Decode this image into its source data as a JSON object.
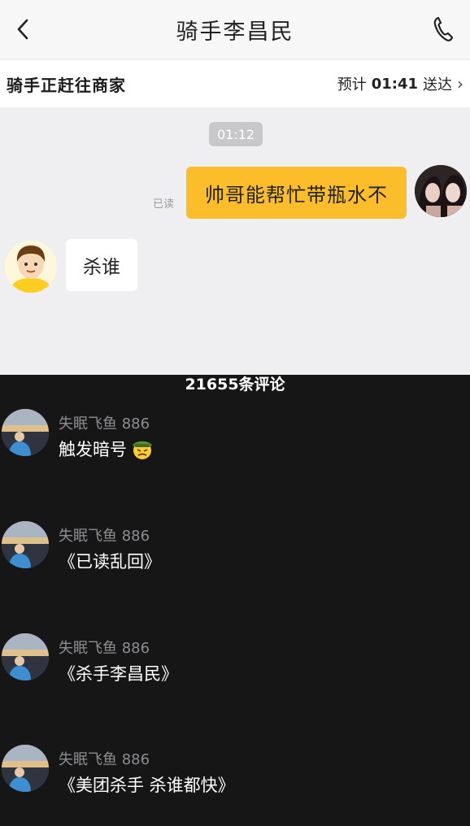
{
  "chat": {
    "title": "骑手李昌民",
    "status_left": "骑手正赶往商家",
    "eta_label": "预计",
    "eta_time": "01:41",
    "eta_suffix": "送达",
    "time_stamp": "01:12",
    "read_mark": "已读",
    "outgoing_message": "帅哥能帮忙带瓶水不",
    "incoming_message": "杀谁",
    "accent_color": "#fbbd2a"
  },
  "comments": {
    "count_label": "21655条评论",
    "items": [
      {
        "user": "失眠飞鱼 886",
        "text": "触发暗号",
        "emoji": "cowboy-face-emoji"
      },
      {
        "user": "失眠飞鱼 886",
        "text": "《已读乱回》"
      },
      {
        "user": "失眠飞鱼 886",
        "text": "《杀手李昌民》"
      },
      {
        "user": "失眠飞鱼 886",
        "text": "《美团杀手 杀谁都快》"
      }
    ]
  }
}
